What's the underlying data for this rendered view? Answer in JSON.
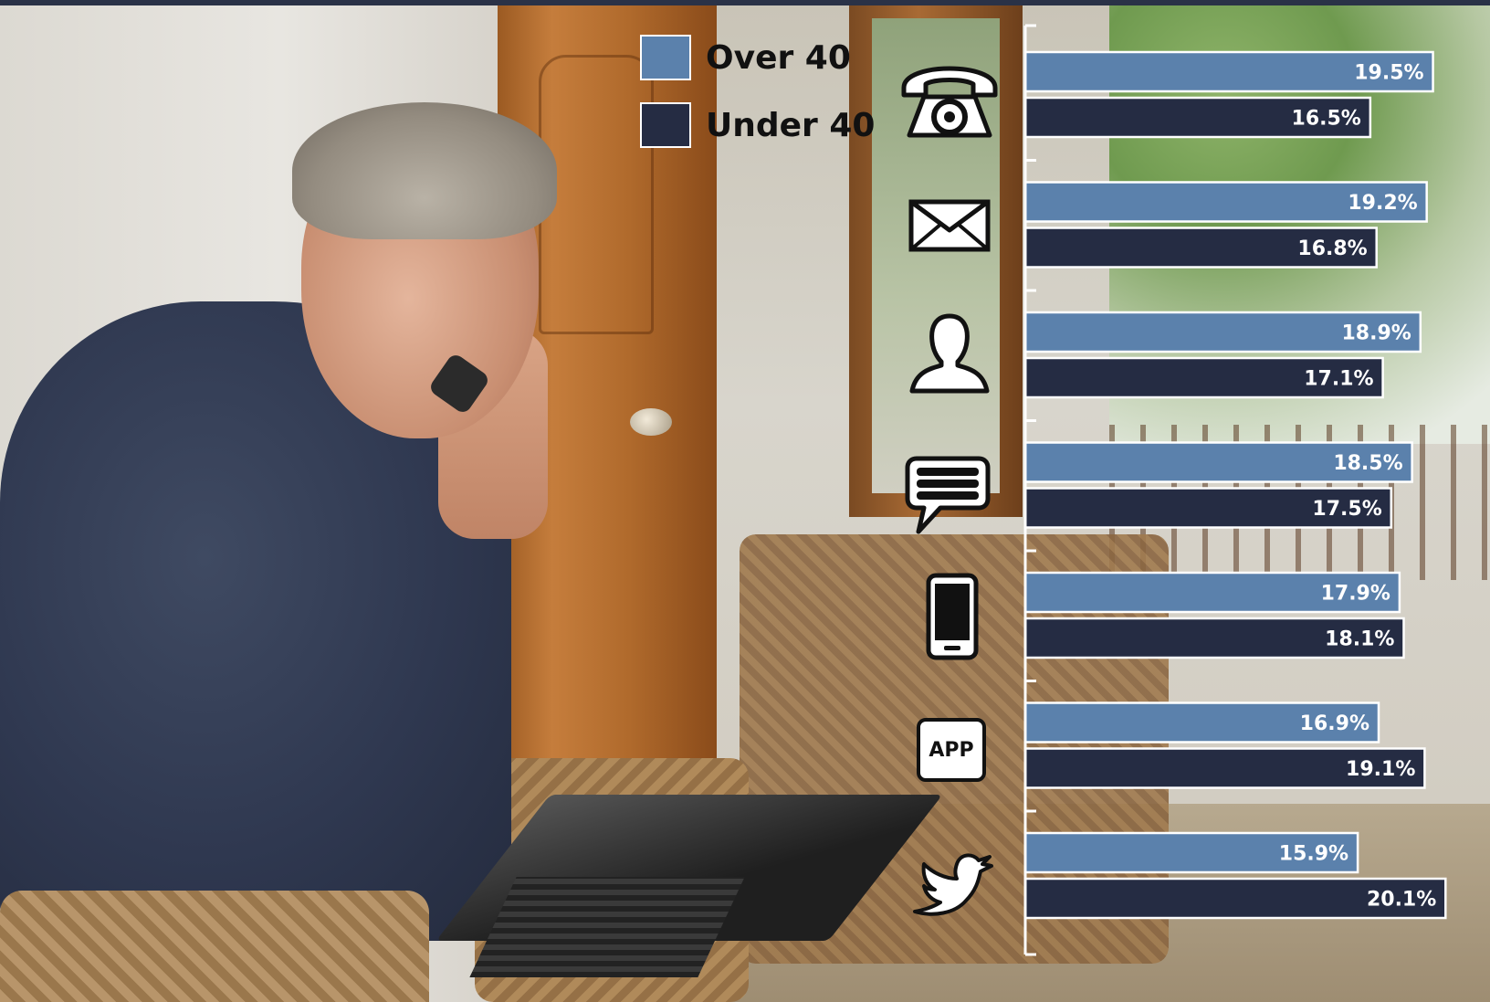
{
  "legend": {
    "over_label": "Over 40",
    "under_label": "Under 40"
  },
  "colors": {
    "over_40": "#5b81ac",
    "under_40": "#252c43",
    "label_text": "#ffffff",
    "axis": "#ffffff"
  },
  "icons": {
    "rows": [
      "telephone-icon",
      "envelope-icon",
      "person-icon",
      "chat-bubble-icon",
      "smartphone-icon",
      "app-icon",
      "bird-icon"
    ],
    "app_text": "APP"
  },
  "chart_data": {
    "type": "bar",
    "orientation": "horizontal",
    "categories": [
      "",
      "",
      "",
      "",
      "",
      "",
      ""
    ],
    "series": [
      {
        "name": "Over 40",
        "values": [
          19.5,
          19.2,
          18.9,
          18.5,
          17.9,
          16.9,
          15.9
        ]
      },
      {
        "name": "Under 40",
        "values": [
          16.5,
          16.8,
          17.1,
          17.5,
          18.1,
          19.1,
          20.1
        ]
      }
    ],
    "value_labels": [
      [
        "19.5%",
        "19.2%",
        "18.9%",
        "18.5%",
        "17.9%",
        "16.9%",
        "15.9%"
      ],
      [
        "16.5%",
        "16.8%",
        "17.1%",
        "17.5%",
        "18.1%",
        "19.1%",
        "20.1%"
      ]
    ],
    "title": "",
    "xlabel": "",
    "ylabel": "",
    "xlim": [
      0,
      20.5
    ],
    "grid": false,
    "legend_position": "top-left"
  }
}
